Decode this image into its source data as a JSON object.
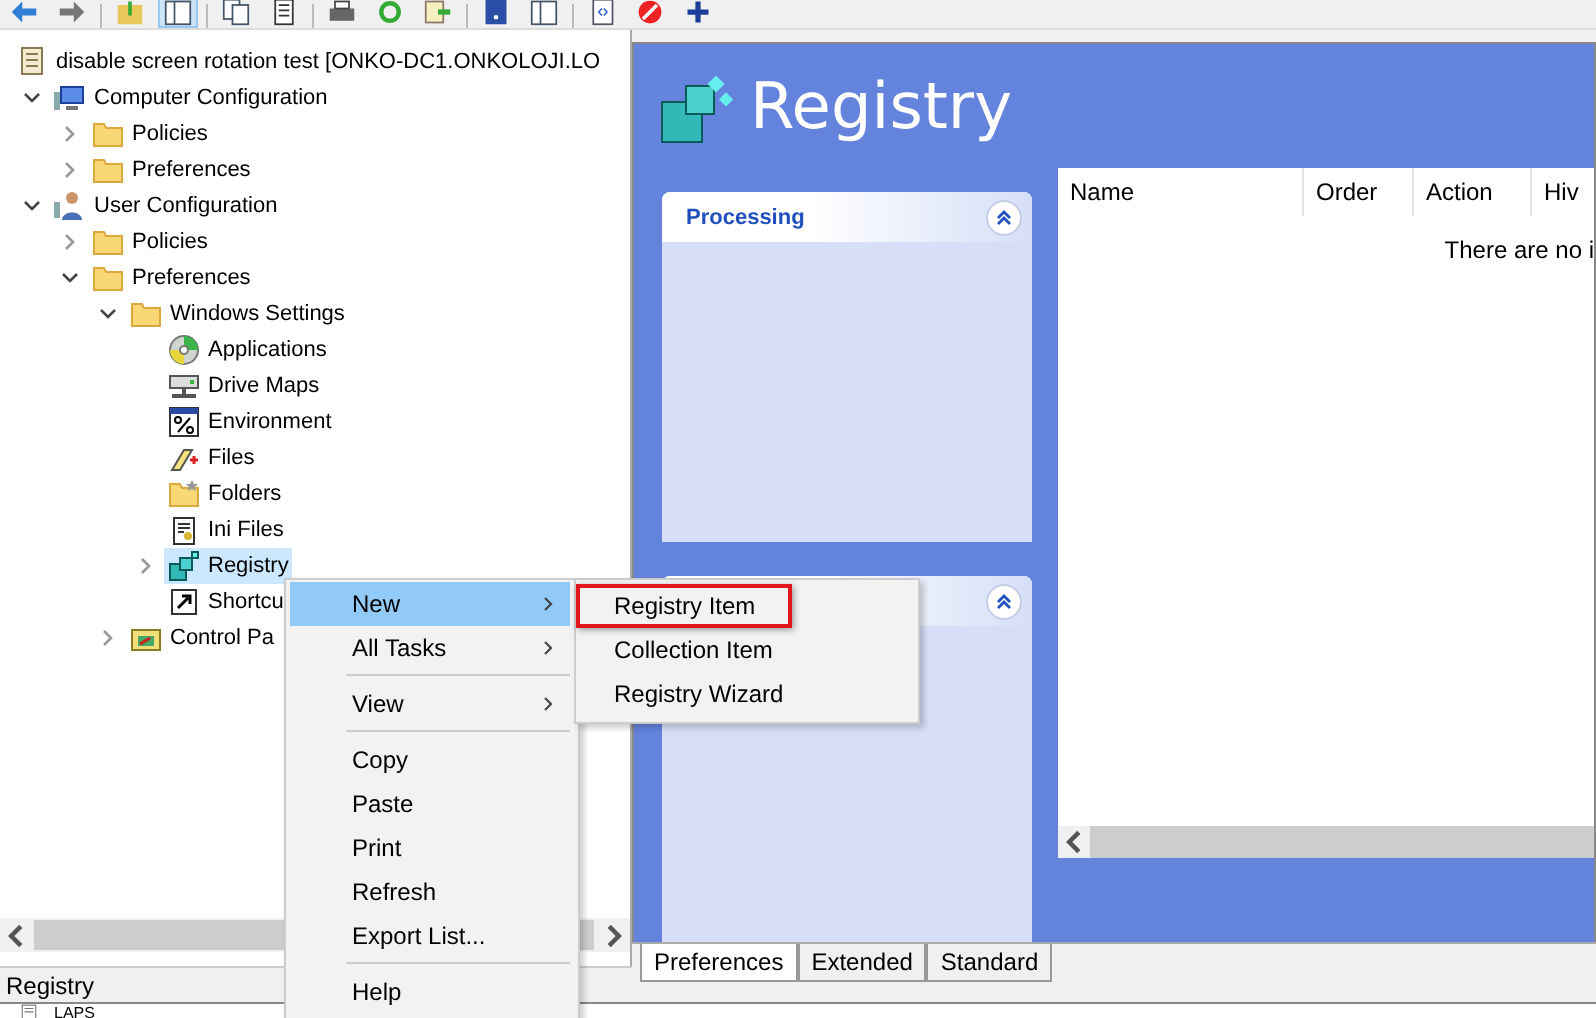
{
  "toolbar": {
    "buttons": [
      {
        "kind": "back",
        "selected": false
      },
      {
        "kind": "forward",
        "selected": false
      },
      {
        "kind": "up",
        "selected": false
      },
      {
        "kind": "pane",
        "selected": true
      },
      {
        "kind": "copy",
        "selected": false
      },
      {
        "kind": "sheet",
        "selected": false
      },
      {
        "kind": "print",
        "selected": false
      },
      {
        "kind": "refresh",
        "selected": false
      },
      {
        "kind": "export",
        "selected": false
      },
      {
        "kind": "help",
        "selected": false
      },
      {
        "kind": "pane",
        "selected": false
      },
      {
        "kind": "xml",
        "selected": false
      },
      {
        "kind": "stop",
        "selected": false
      },
      {
        "kind": "add",
        "selected": false
      }
    ]
  },
  "tree": {
    "items": [
      {
        "label": "disable screen rotation test [ONKO-DC1.ONKOLOJI.LO",
        "kind": "document",
        "selected": false,
        "children": [
          {
            "label": "Computer Configuration",
            "kind": "computer",
            "selected": false,
            "expanded": true,
            "children": [
              {
                "label": "Policies",
                "kind": "folder",
                "selected": false,
                "expanded": false
              },
              {
                "label": "Preferences",
                "kind": "folder",
                "selected": false,
                "expanded": false
              }
            ]
          },
          {
            "label": "User Configuration",
            "kind": "user",
            "selected": false,
            "expanded": true,
            "children": [
              {
                "label": "Policies",
                "kind": "folder",
                "selected": false,
                "expanded": false
              },
              {
                "label": "Preferences",
                "kind": "folder",
                "selected": false,
                "expanded": true,
                "children": [
                  {
                    "label": "Windows Settings",
                    "kind": "folder",
                    "selected": false,
                    "expanded": true,
                    "children": [
                      {
                        "label": "Applications",
                        "kind": "disc",
                        "selected": false
                      },
                      {
                        "label": "Drive Maps",
                        "kind": "drive",
                        "selected": false
                      },
                      {
                        "label": "Environment",
                        "kind": "percent",
                        "selected": false
                      },
                      {
                        "label": "Files",
                        "kind": "file",
                        "selected": false
                      },
                      {
                        "label": "Folders",
                        "kind": "folder-star",
                        "selected": false
                      },
                      {
                        "label": "Ini Files",
                        "kind": "ini",
                        "selected": false
                      },
                      {
                        "label": "Registry",
                        "kind": "registry",
                        "selected": true,
                        "expanded": false
                      },
                      {
                        "label": "Shortcu",
                        "kind": "shortcut",
                        "selected": false
                      }
                    ]
                  },
                  {
                    "label": "Control Pa",
                    "kind": "control",
                    "selected": false,
                    "expanded": false
                  }
                ]
              }
            ]
          }
        ]
      }
    ]
  },
  "status_bar": "Registry",
  "background_window": {
    "item": "LAPS"
  },
  "panel": {
    "title": "Registry",
    "cards": [
      {
        "title": "Processing",
        "expanded": true
      },
      {
        "expanded": true
      }
    ],
    "table": {
      "columns": [
        "Name",
        "Order",
        "Action",
        "Hiv"
      ],
      "empty_message": "There are no i"
    },
    "tabs": [
      {
        "label": "Preferences",
        "selected": true
      },
      {
        "label": "Extended",
        "selected": false
      },
      {
        "label": "Standard",
        "selected": false
      }
    ]
  },
  "context_menu": {
    "groups": [
      [
        {
          "label": "New",
          "selected": true,
          "submenu": true
        },
        {
          "label": "All Tasks",
          "selected": false,
          "submenu": true
        }
      ],
      [
        {
          "label": "View",
          "selected": false,
          "submenu": true
        }
      ],
      [
        {
          "label": "Copy",
          "selected": false,
          "submenu": false
        },
        {
          "label": "Paste",
          "selected": false,
          "submenu": false
        },
        {
          "label": "Print",
          "selected": false,
          "submenu": false
        },
        {
          "label": "Refresh",
          "selected": false,
          "submenu": false
        },
        {
          "label": "Export List...",
          "selected": false,
          "submenu": false
        }
      ],
      [
        {
          "label": "Help",
          "selected": false,
          "submenu": false
        }
      ]
    ]
  },
  "submenu": {
    "items": [
      {
        "label": "Registry Item",
        "outlined": true
      },
      {
        "label": "Collection Item",
        "outlined": false
      },
      {
        "label": "Registry Wizard",
        "outlined": false
      }
    ]
  }
}
